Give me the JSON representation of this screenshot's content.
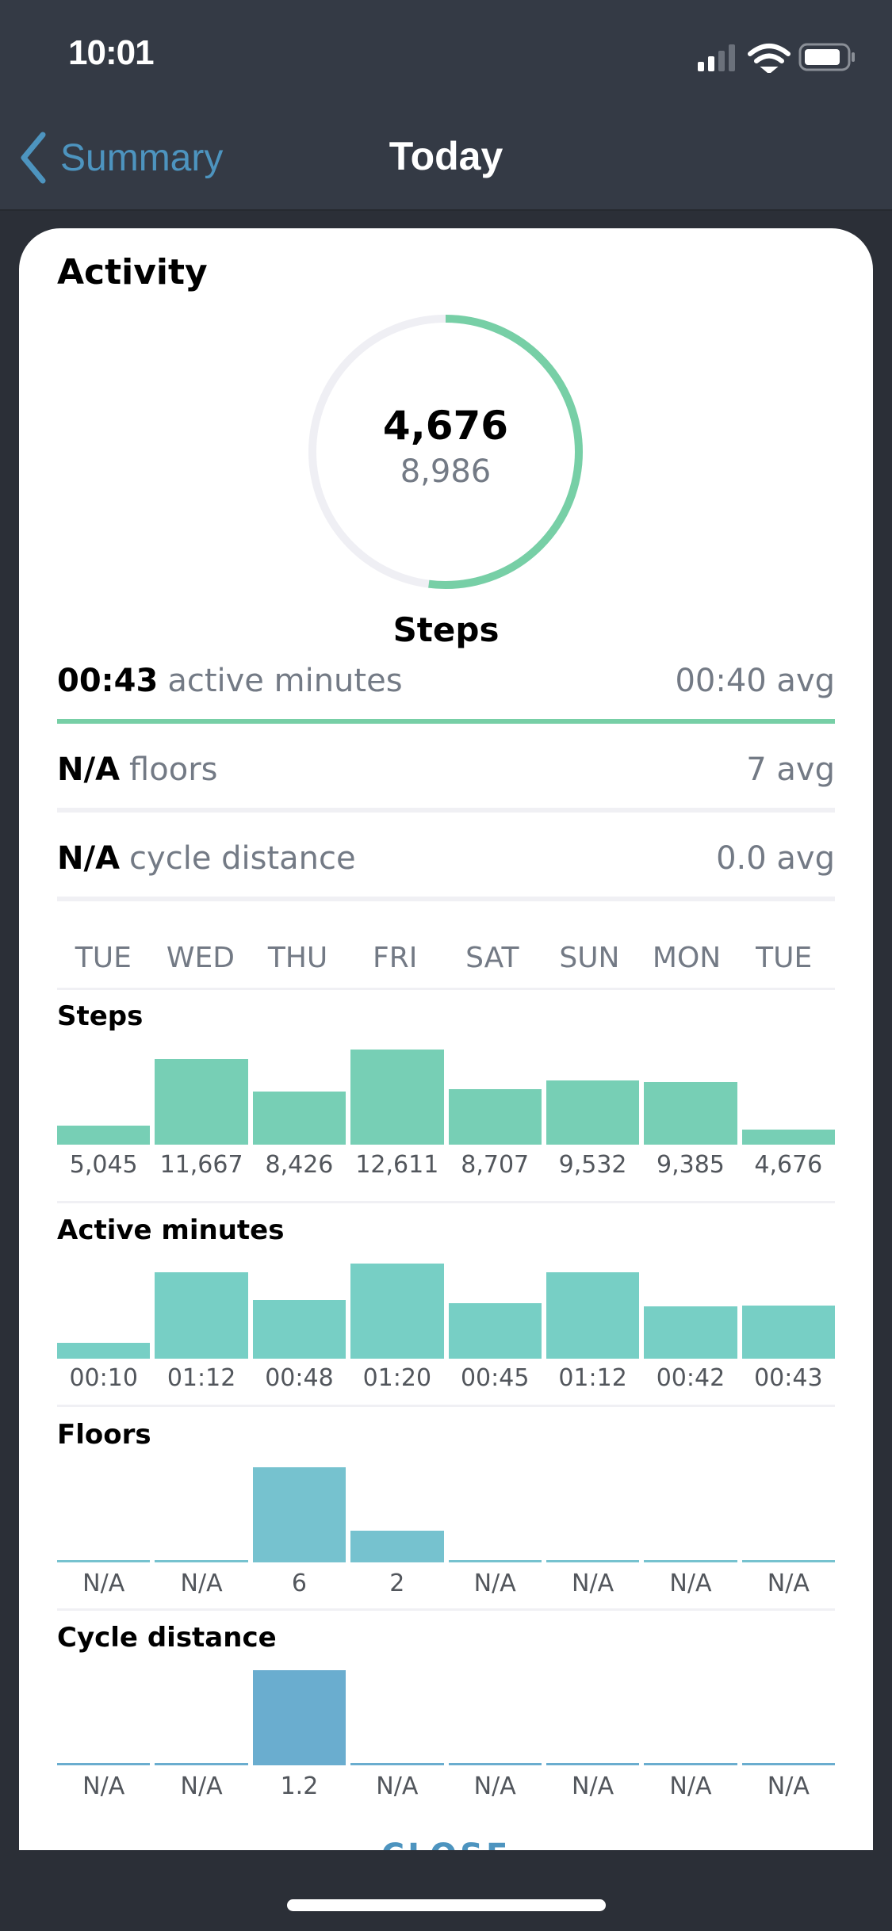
{
  "status_bar": {
    "time": "10:01",
    "signal_bars": 2,
    "signal_max": 4,
    "wifi": "wifi-icon",
    "battery_level": 0.8
  },
  "nav": {
    "back_label": "Summary",
    "title": "Today"
  },
  "card": {
    "title": "Activity",
    "ring": {
      "value": "4,676",
      "goal": "8,986",
      "label": "Steps",
      "progress": 0.52,
      "color": "#77cfa6",
      "track_color": "#efeff4"
    },
    "stats": [
      {
        "value": "00:43",
        "label": "active minutes",
        "avg": "00:40 avg",
        "progress": 1.0
      },
      {
        "value": "N/A",
        "label": "floors",
        "avg": "7 avg",
        "progress": 0
      },
      {
        "value": "N/A",
        "label": "cycle distance",
        "avg": "0.0 avg",
        "progress": 0
      }
    ],
    "days": [
      "TUE",
      "WED",
      "THU",
      "FRI",
      "SAT",
      "SUN",
      "MON",
      "TUE"
    ],
    "close_label": "CLOSE"
  },
  "chart_data": [
    {
      "type": "bar",
      "title": "Steps",
      "categories": [
        "TUE",
        "WED",
        "THU",
        "FRI",
        "SAT",
        "SUN",
        "MON",
        "TUE"
      ],
      "values": [
        5045,
        11667,
        8426,
        12611,
        8707,
        9532,
        9385,
        4676
      ],
      "labels": [
        "5,045",
        "11,667",
        "8,426",
        "12,611",
        "8,707",
        "9,532",
        "9,385",
        "4,676"
      ],
      "ylim": [
        3150,
        12611
      ],
      "color": "#77cfb5"
    },
    {
      "type": "bar",
      "title": "Active minutes",
      "categories": [
        "TUE",
        "WED",
        "THU",
        "FRI",
        "SAT",
        "SUN",
        "MON",
        "TUE"
      ],
      "values": [
        10,
        72,
        48,
        80,
        45,
        72,
        42,
        43
      ],
      "labels": [
        "00:10",
        "01:12",
        "00:48",
        "01:20",
        "00:45",
        "01:12",
        "00:42",
        "00:43"
      ],
      "ylim": [
        -4,
        80
      ],
      "color": "#77cfc5"
    },
    {
      "type": "bar",
      "title": "Floors",
      "categories": [
        "TUE",
        "WED",
        "THU",
        "FRI",
        "SAT",
        "SUN",
        "MON",
        "TUE"
      ],
      "values": [
        null,
        null,
        6,
        2,
        null,
        null,
        null,
        null
      ],
      "labels": [
        "N/A",
        "N/A",
        "6",
        "2",
        "N/A",
        "N/A",
        "N/A",
        "N/A"
      ],
      "ylim": [
        0,
        6
      ],
      "color": "#76c2cf"
    },
    {
      "type": "bar",
      "title": "Cycle distance",
      "categories": [
        "TUE",
        "WED",
        "THU",
        "FRI",
        "SAT",
        "SUN",
        "MON",
        "TUE"
      ],
      "values": [
        null,
        null,
        1.2,
        null,
        null,
        null,
        null,
        null
      ],
      "labels": [
        "N/A",
        "N/A",
        "1.2",
        "N/A",
        "N/A",
        "N/A",
        "N/A",
        "N/A"
      ],
      "ylim": [
        0,
        1.2
      ],
      "color": "#6aadcf"
    }
  ]
}
